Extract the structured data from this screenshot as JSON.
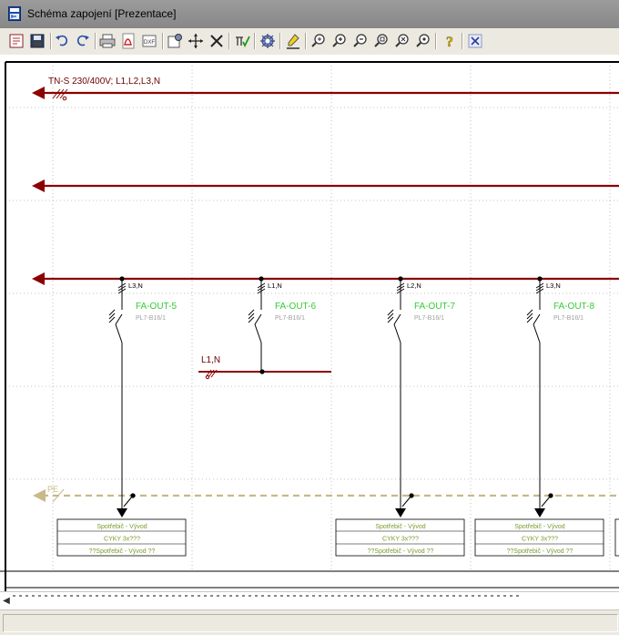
{
  "window": {
    "title": "Schéma zapojení [Prezentace]"
  },
  "toolbar": {
    "buttons": [
      {
        "name": "properties-icon"
      },
      {
        "name": "save-icon"
      },
      {
        "name": "undo-icon"
      },
      {
        "name": "redo-icon"
      },
      {
        "name": "print-icon"
      },
      {
        "name": "pdf-export-icon"
      },
      {
        "name": "export-icon"
      },
      {
        "name": "settings-icon"
      },
      {
        "name": "move-icon"
      },
      {
        "name": "delete-icon"
      },
      {
        "name": "check-icon"
      },
      {
        "name": "component-icon"
      },
      {
        "name": "highlight-icon"
      },
      {
        "name": "zoom-pan-icon"
      },
      {
        "name": "zoom-in-icon"
      },
      {
        "name": "zoom-out-icon"
      },
      {
        "name": "zoom-window-icon"
      },
      {
        "name": "zoom-all-icon"
      },
      {
        "name": "zoom-fit-icon"
      },
      {
        "name": "help-icon"
      },
      {
        "name": "close-icon"
      }
    ]
  },
  "schema": {
    "bus_label": "TN-S 230/400V; L1,L2,L3,N",
    "pe_label": "PE",
    "feeder_bus_label": "L1,N",
    "outputs": [
      {
        "phase": "L3,N",
        "name": "FA-OUT-5",
        "type": "PL7-B16/1",
        "has_load": true
      },
      {
        "phase": "L1,N",
        "name": "FA-OUT-6",
        "type": "PL7-B16/1",
        "has_load": false
      },
      {
        "phase": "L2,N",
        "name": "FA-OUT-7",
        "type": "PL7-B16/1",
        "has_load": true
      },
      {
        "phase": "L3,N",
        "name": "FA-OUT-8",
        "type": "PL7-B16/1",
        "has_load": true
      }
    ],
    "load_box": {
      "line1": "Spotřebič - Vývod",
      "line2": "CYKY 3x???",
      "line3": "??Spotřebič - Vývod ??"
    },
    "colors": {
      "bus": "#8b0000",
      "pe": "#c8b98a",
      "device_name": "#33cc33",
      "device_type": "#a0a0a0",
      "load_text": "#7a9a30",
      "grid": "#b0b0b0"
    }
  }
}
